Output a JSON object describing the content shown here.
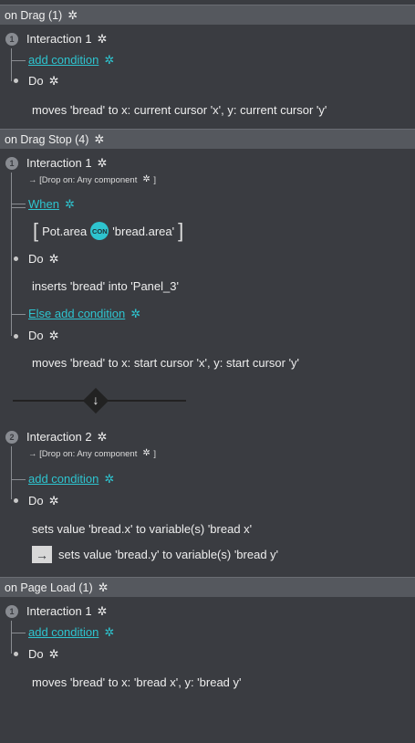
{
  "sections": [
    {
      "header": "on Drag (1)",
      "interaction": "Interaction 1",
      "number": "1",
      "condition_link": "add condition",
      "do_label": "Do",
      "action": "moves 'bread' to x: current cursor 'x', y: current cursor 'y'"
    },
    {
      "header": "on Drag Stop (4)",
      "interaction1": {
        "number": "1",
        "label": "Interaction 1",
        "trigger_note": "→ [Drop on: Any component",
        "trigger_close": "]",
        "when_link": "When",
        "condition_left": "Pot.area",
        "condition_op": "CON",
        "condition_right": "'bread.area'",
        "bracket_open": "[",
        "bracket_close": "]",
        "do_label": "Do",
        "action": "inserts 'bread' into 'Panel_3'",
        "else_link": "Else add condition",
        "else_do_label": "Do",
        "else_action": "moves 'bread' to x: start cursor 'x', y: start cursor 'y'"
      },
      "divider_arrow": "↓",
      "interaction2": {
        "number": "2",
        "label": "Interaction 2",
        "trigger_note": "→ [Drop on: Any component",
        "trigger_close": "]",
        "condition_link": "add condition",
        "do_label": "Do",
        "action1": "sets value 'bread.x' to variable(s) 'bread x'",
        "action2_arrow": "→",
        "action2": "sets value 'bread.y' to variable(s) 'bread y'"
      }
    },
    {
      "header": "on Page Load (1)",
      "interaction": "Interaction 1",
      "number": "1",
      "condition_link": "add condition",
      "do_label": "Do",
      "action": "moves 'bread' to x: 'bread x', y: 'bread y'"
    }
  ],
  "icons": {
    "gear": "✲"
  },
  "colors": {
    "background": "#3a3c41",
    "header": "#55585e",
    "accent": "#2ec4cf"
  }
}
